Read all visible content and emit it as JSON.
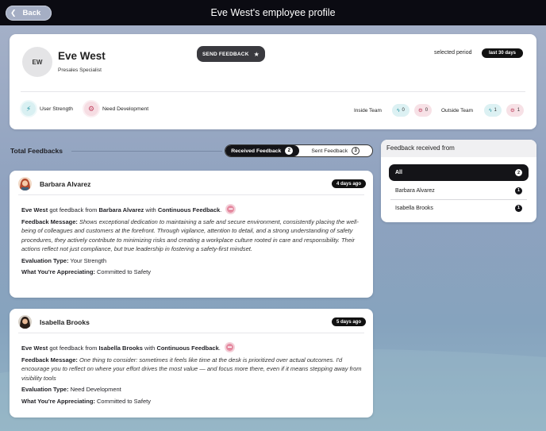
{
  "header": {
    "back_label": "Back",
    "title": "Eve West's employee profile"
  },
  "profile": {
    "initials": "EW",
    "name": "Eve West",
    "role": "Presales Specialist",
    "send_feedback_label": "SEND FEEDBACK",
    "period_label": "selected period",
    "period_value": "last 30 days",
    "legend": {
      "strength_label": "User Strength",
      "development_label": "Need Development"
    },
    "inside_team": {
      "label": "Inside Team",
      "strength_count": "0",
      "development_count": "0"
    },
    "outside_team": {
      "label": "Outside Team",
      "strength_count": "1",
      "development_count": "1"
    }
  },
  "feedbacks": {
    "section_label": "Total Feedbacks",
    "tabs": [
      {
        "label": "Received Feedback",
        "count": "2",
        "active": true
      },
      {
        "label": "Sent Feedback",
        "count": "3",
        "active": false
      }
    ],
    "items": [
      {
        "name": "Barbara Alvarez",
        "ago": "4 days ago",
        "recipient": "Eve West",
        "got_text": "got feedback from",
        "from": "Barbara Alvarez",
        "with_text": "with",
        "type": "Continuous Feedback",
        "message_label": "Feedback Message:",
        "message": "Shows exceptional dedication to maintaining a safe and secure environment, consistently placing the well-being of colleagues and customers at the forefront. Through vigilance, attention to detail, and a strong understanding of safety procedures, they actively contribute to minimizing risks and creating a workplace culture rooted in care and responsibility. Their actions reflect not just compliance, but true leadership in fostering a safety-first mindset.",
        "evaluation_label": "Evaluation Type:",
        "evaluation": "Your Strength",
        "appreciating_label": "What You're Appreciating:",
        "appreciating": "Committed to Safety"
      },
      {
        "name": "Isabella Brooks",
        "ago": "5 days ago",
        "recipient": "Eve West",
        "got_text": "got feedback from",
        "from": "Isabella Brooks",
        "with_text": "with",
        "type": "Continuous Feedback",
        "message_label": "Feedback Message:",
        "message": "One thing to consider: sometimes it feels like time at the desk is prioritized over actual outcomes. I'd encourage you to reflect on where your effort drives the most value — and focus more there, even if it means stepping away from visibility tools",
        "evaluation_label": "Evaluation Type:",
        "evaluation": "Need Development",
        "appreciating_label": "What You're Appreciating:",
        "appreciating": "Committed to Safety"
      }
    ]
  },
  "filter": {
    "title": "Feedback received from",
    "items": [
      {
        "label": "All",
        "count": "2",
        "selected": true
      },
      {
        "label": "Barbara Alvarez",
        "count": "1",
        "selected": false
      },
      {
        "label": "Isabella Brooks",
        "count": "1",
        "selected": false
      }
    ]
  },
  "colors": {
    "topbar": "#0b0b12",
    "strength": "#1b8e9d",
    "development": "#c0415f",
    "active": "#141418"
  },
  "icons": {
    "back": "chevron-left-icon",
    "send": "star-icon",
    "strength": "bolt-icon",
    "development": "gear-icon",
    "feedback_type": "chat-bubble-icon"
  }
}
